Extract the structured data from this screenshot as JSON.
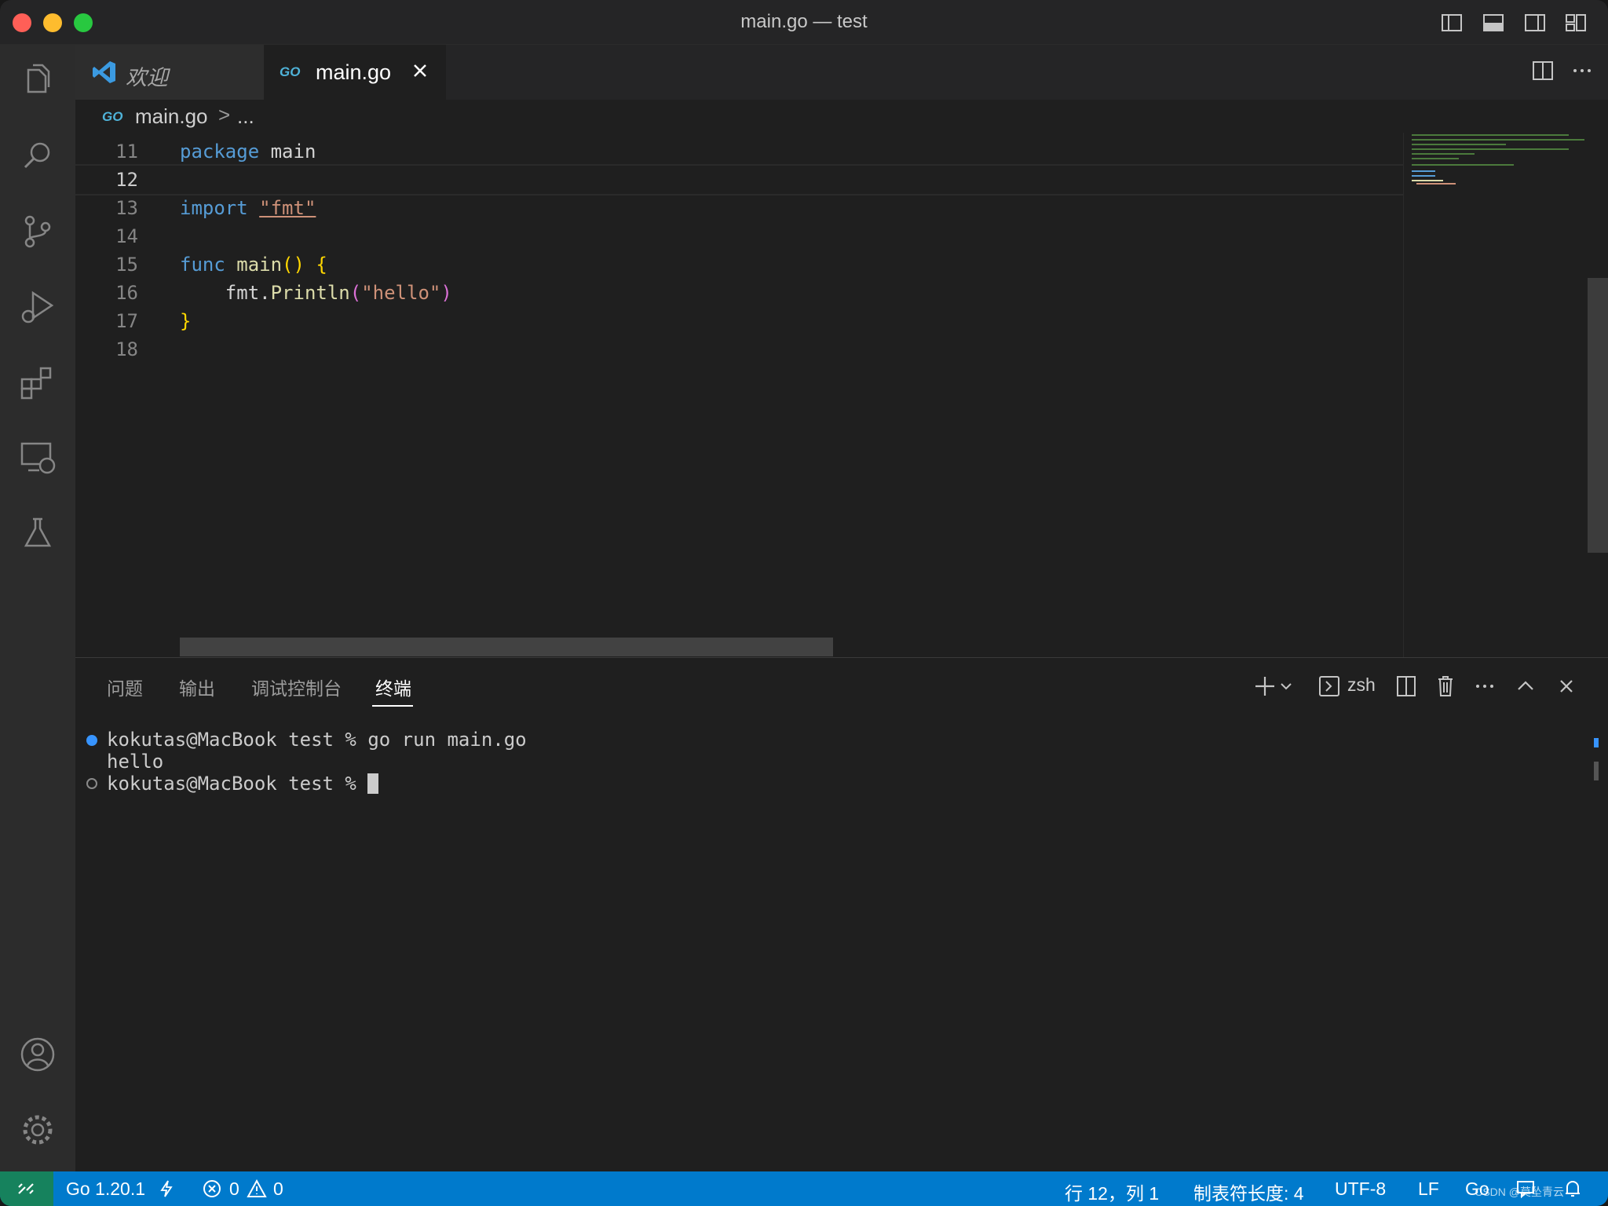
{
  "window": {
    "title": "main.go — test"
  },
  "tabs": [
    {
      "label": "欢迎",
      "active": false
    },
    {
      "label": "main.go",
      "active": true,
      "icon_text": "GO"
    }
  ],
  "breadcrumb": {
    "file": "main.go",
    "separator": ">",
    "more": "..."
  },
  "editor": {
    "lines": [
      {
        "num": "11"
      },
      {
        "num": "12"
      },
      {
        "num": "13"
      },
      {
        "num": "14"
      },
      {
        "num": "15"
      },
      {
        "num": "16"
      },
      {
        "num": "17"
      },
      {
        "num": "18"
      }
    ],
    "code": {
      "l11_kw": "package",
      "l11_rest": " main",
      "l13_kw": "import",
      "l13_str": "\"fmt\"",
      "l15_kw": "func",
      "l15_fn": "main",
      "l15_paren": "()",
      "l15_brace": "{",
      "l16_indent": "    ",
      "l16_obj": "fmt.",
      "l16_fn": "Println",
      "l16_open": "(",
      "l16_str": "\"hello\"",
      "l16_close": ")",
      "l17_brace": "}"
    }
  },
  "panel": {
    "tabs": [
      "问题",
      "输出",
      "调试控制台",
      "终端"
    ],
    "active_tab": "终端",
    "shell": "zsh",
    "terminal": {
      "line1": "kokutas@MacBook test % go run main.go",
      "line2": "hello",
      "line3": "kokutas@MacBook test % "
    }
  },
  "statusbar": {
    "go_version": "Go 1.20.1",
    "errors": "0",
    "warnings": "0",
    "position": "行 12，列 1",
    "tab_size": "制表符长度: 4",
    "encoding": "UTF-8",
    "eol": "LF",
    "language": "Go",
    "watermark": "CSDN @莫坠青云"
  },
  "colors": {
    "statusbar": "#007acc",
    "keyword": "#569cd6",
    "function": "#dcdcaa",
    "string": "#ce9178"
  }
}
